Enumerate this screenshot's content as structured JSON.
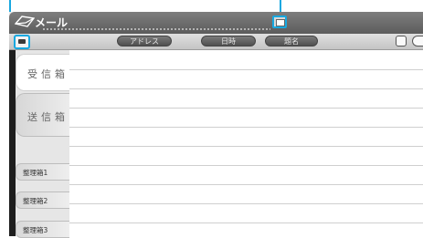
{
  "window": {
    "title": "メール",
    "logo_icon": "envelope-outline-icon",
    "screen_icon": "screen-toggle-icon"
  },
  "toolbar": {
    "left_icon": "mailbox-icon",
    "address_label": "アドレス",
    "date_label": "日時",
    "subject_label": "題名",
    "right_icons": [
      "page-icon",
      "next-page-icon"
    ]
  },
  "sidebar": {
    "folders": [
      {
        "label": "受信箱",
        "active": true
      },
      {
        "label": "送信箱",
        "active": false
      }
    ],
    "sub_folders": [
      {
        "label": "整理箱1"
      },
      {
        "label": "整理箱2"
      },
      {
        "label": "整理箱3"
      }
    ]
  },
  "colors": {
    "callout": "#18a8e0",
    "titlebar": "#6a6a6a",
    "sidebar_edge": "#1d1d1d"
  }
}
